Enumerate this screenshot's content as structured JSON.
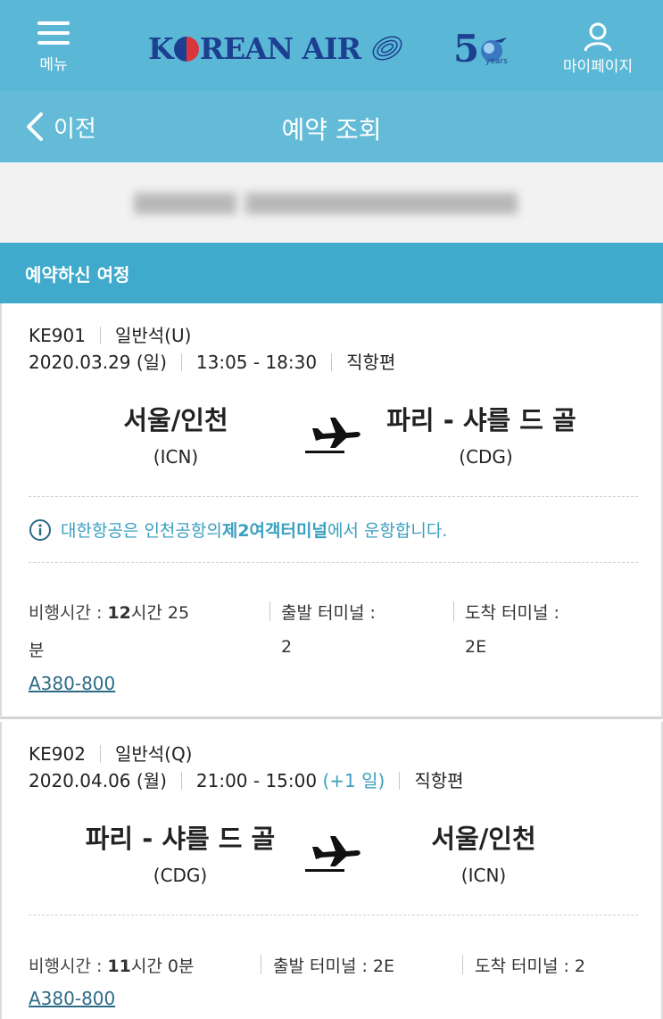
{
  "header": {
    "menu_label": "메뉴",
    "logo_text_k": "K",
    "logo_text_rest": "REAN AIR",
    "anniversary": "5",
    "anniversary_years": "years",
    "mypage_label": "마이페이지",
    "brand_color": "#1d3f8f",
    "bar_color": "#5ab8d6"
  },
  "subheader": {
    "back_label": "이전",
    "title": "예약 조회"
  },
  "section_title": "예약하신 여정",
  "flights": [
    {
      "flight_no": "KE901",
      "cabin": "일반석(U)",
      "date": "2020.03.29 (일)",
      "time": "13:05 - 18:30",
      "day_offset": "",
      "type": "직항편",
      "origin_city": "서울/인천",
      "origin_code": "(ICN)",
      "dest_city": "파리 - 샤를 드 골",
      "dest_code": "(CDG)",
      "notice_pre": "대한항공은 인천공항의 ",
      "notice_bold": "제2여객터미널",
      "notice_post": "에서 운항합니다.",
      "duration_label": "비행시간 : ",
      "duration_value": "12",
      "duration_unit": "시간 25",
      "duration_wrap": "분",
      "dep_terminal_label": "출발 터미널 :",
      "dep_terminal": "2",
      "arr_terminal_label": "도착 터미널 :",
      "arr_terminal": "2E",
      "aircraft": "A380-800"
    },
    {
      "flight_no": "KE902",
      "cabin": "일반석(Q)",
      "date": "2020.04.06 (월)",
      "time": "21:00 - 15:00",
      "day_offset": "(+1 일)",
      "type": "직항편",
      "origin_city": "파리 - 샤를 드 골",
      "origin_code": "(CDG)",
      "dest_city": "서울/인천",
      "dest_code": "(ICN)",
      "duration_label": "비행시간 : ",
      "duration_value": "11",
      "duration_unit": "시간 0분",
      "dep_terminal_label": "출발 터미널 : ",
      "dep_terminal": "2E",
      "arr_terminal_label": "도착 터미널 : ",
      "arr_terminal": "2",
      "aircraft": "A380-800"
    }
  ]
}
